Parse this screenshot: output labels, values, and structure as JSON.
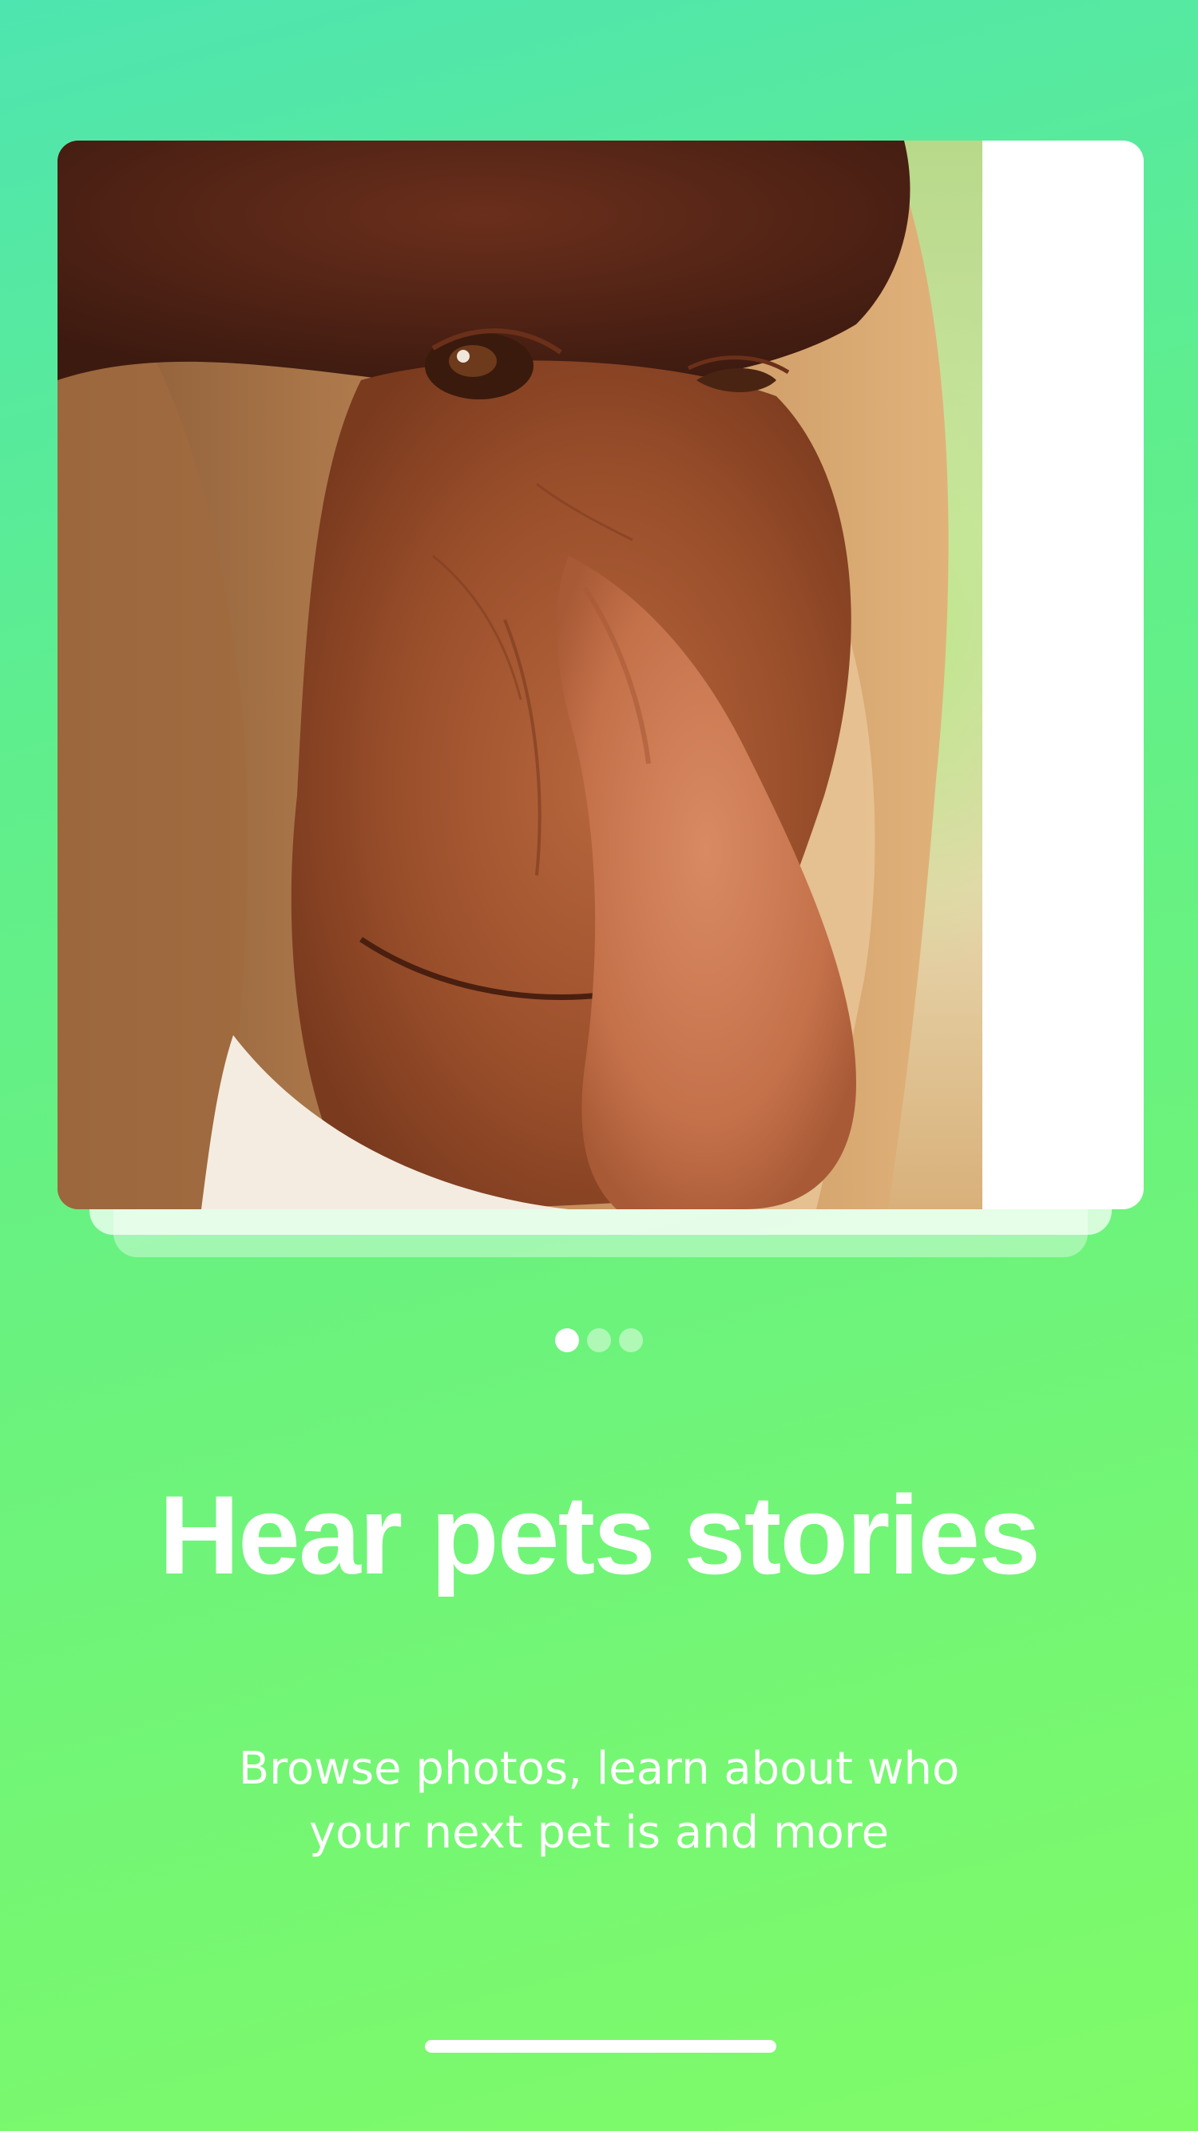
{
  "carousel": {
    "slides": [
      {
        "image_alt": "Close-up of a proboscis monkey face",
        "active": true
      },
      {
        "active": false
      },
      {
        "active": false
      }
    ]
  },
  "headline": "Hear pets stories",
  "subtitle": "Browse photos, learn about who your next pet is and more",
  "colors": {
    "background_top": "#4ee5b0",
    "background_bottom": "#80fb68",
    "text": "#ffffff"
  }
}
